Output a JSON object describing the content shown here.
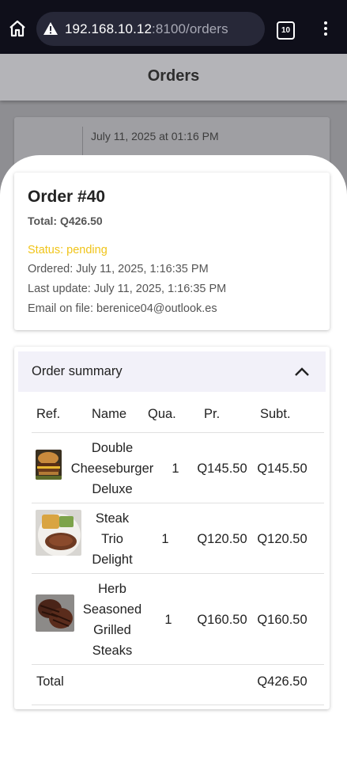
{
  "browser": {
    "url_host": "192.168.10.12",
    "url_path": ":8100/orders",
    "tab_count": "10"
  },
  "page": {
    "title": "Orders",
    "background_card_date": "July 11, 2025 at 01:16 PM"
  },
  "order": {
    "title": "Order #40",
    "total": "Total: Q426.50",
    "status": "Status: pending",
    "ordered": "Ordered: July 11, 2025, 1:16:35 PM",
    "last_update": "Last update: July 11, 2025, 1:16:35 PM",
    "email": "Email on file: berenice04@outlook.es",
    "status_color": "#f0c419"
  },
  "summary": {
    "label": "Order summary",
    "headers": [
      "Ref.",
      "Name",
      "Qua.",
      "Pr.",
      "Subt."
    ],
    "rows": [
      {
        "name_lines": [
          "Double",
          "Cheeseburger",
          "Deluxe"
        ],
        "qty": "1",
        "price": "Q145.50",
        "subtotal": "Q145.50",
        "image": "burger-image"
      },
      {
        "name_lines": [
          "Steak",
          "Trio",
          "Delight"
        ],
        "qty": "1",
        "price": "Q120.50",
        "subtotal": "Q120.50",
        "image": "steak-plate-image"
      },
      {
        "name_lines": [
          "Herb",
          "Seasoned",
          "Grilled",
          "Steaks"
        ],
        "qty": "1",
        "price": "Q160.50",
        "subtotal": "Q160.50",
        "image": "grilled-steaks-image"
      }
    ],
    "total_label": "Total",
    "total_value": "Q426.50"
  }
}
